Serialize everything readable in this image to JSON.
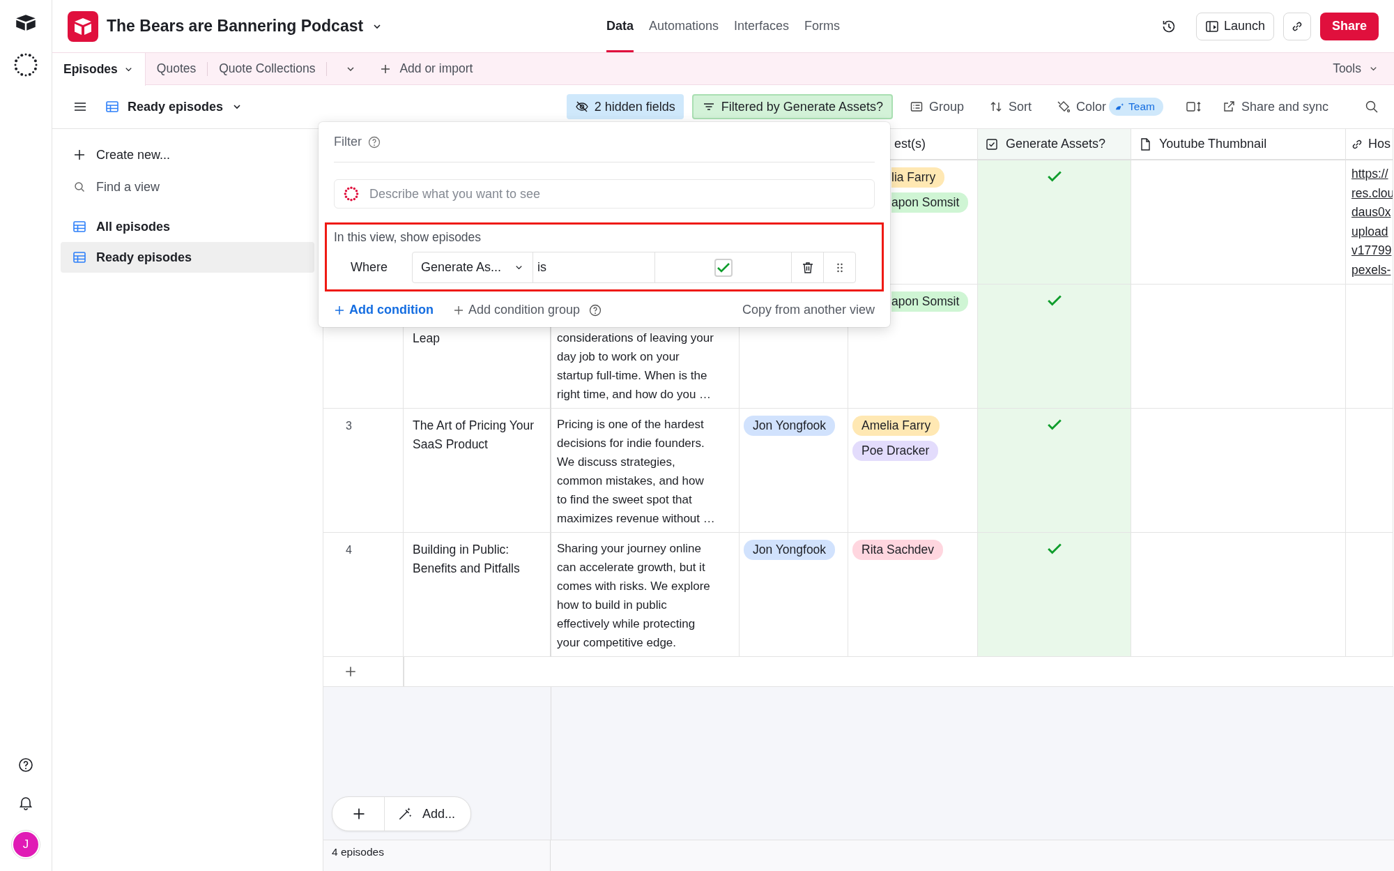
{
  "rail": {
    "avatar": "J"
  },
  "base": {
    "title": "The Bears are Bannering Podcast"
  },
  "nav": [
    {
      "label": "Data",
      "selected": true
    },
    {
      "label": "Automations",
      "selected": false
    },
    {
      "label": "Interfaces",
      "selected": false
    },
    {
      "label": "Forms",
      "selected": false
    }
  ],
  "actions": {
    "launch": "Launch",
    "share": "Share"
  },
  "tables": [
    {
      "label": "Episodes",
      "selected": true
    },
    {
      "label": "Quotes",
      "selected": false
    },
    {
      "label": "Quote Collections",
      "selected": false
    }
  ],
  "add_table": "Add or import",
  "tools": "Tools",
  "view": {
    "name": "Ready episodes"
  },
  "view_tools": [
    {
      "kind": "hidden",
      "label": "2 hidden fields"
    },
    {
      "kind": "filter",
      "label": "Filtered by Generate Assets?"
    },
    {
      "kind": "group",
      "label": "Group"
    },
    {
      "kind": "sort",
      "label": "Sort"
    },
    {
      "kind": "color",
      "label": "Color",
      "badge": "Team"
    },
    {
      "kind": "height"
    },
    {
      "kind": "share",
      "label": "Share and sync"
    },
    {
      "kind": "search"
    }
  ],
  "sidebar": {
    "actions": [
      {
        "kind": "create",
        "label": "Create new..."
      },
      {
        "kind": "find",
        "label": "Find a view"
      }
    ],
    "views": [
      {
        "label": "All episodes",
        "selected": false
      },
      {
        "label": "Ready episodes",
        "selected": true
      }
    ]
  },
  "table": {
    "columns": [
      {
        "kind": "text",
        "label": "est(s)"
      },
      {
        "kind": "checkbox",
        "label": "Generate Assets?"
      },
      {
        "kind": "attachment",
        "label": "Youtube Thumbnail"
      },
      {
        "kind": "url",
        "label": "Hos"
      }
    ],
    "rows": [
      {
        "guests": [
          {
            "name": "lia Farry",
            "color": "#ffe8b3"
          },
          {
            "name": "apon Somsit",
            "color": "#cff5d4"
          }
        ],
        "generate": true,
        "url_lines": [
          "https://",
          "res.clou",
          "daus0x",
          "upload",
          "v17799",
          "pexels-"
        ]
      },
      {
        "title": [
          "Leap"
        ],
        "description": [
          "considerations of leaving your",
          "day job to work on your",
          "startup full-time. When is the",
          "right time, and how do you …"
        ],
        "guests": [
          {
            "name": "apon Somsit",
            "color": "#cff5d4"
          }
        ],
        "generate": true
      },
      {
        "number": "3",
        "title": [
          "The Art of Pricing Your",
          "SaaS Product"
        ],
        "description": [
          "Pricing is one of the hardest",
          "decisions for indie founders.",
          "We discuss strategies,",
          "common mistakes, and how",
          "to find the sweet spot that",
          "maximizes revenue without …"
        ],
        "host": [
          {
            "name": "Jon Yongfook",
            "color": "#d1e2fd"
          }
        ],
        "guests": [
          {
            "name": "Amelia Farry",
            "color": "#ffe8b3"
          },
          {
            "name": "Poe Dracker",
            "color": "#e3dcfc"
          }
        ],
        "generate": true
      },
      {
        "number": "4",
        "title": [
          "Building in Public:",
          "Benefits and Pitfalls"
        ],
        "description": [
          "Sharing your journey online",
          "can accelerate growth, but it",
          "comes with risks. We explore",
          "how to build in public",
          "effectively while protecting",
          "your competitive edge."
        ],
        "host": [
          {
            "name": "Jon Yongfook",
            "color": "#d1e2fd"
          }
        ],
        "guests": [
          {
            "name": "Rita Sachdev",
            "color": "#ffd6df"
          }
        ],
        "generate": true
      }
    ],
    "add_label": "Add...",
    "footer": "4 episodes"
  },
  "filter_popup": {
    "title": "Filter",
    "ai_placeholder": "Describe what you want to see",
    "intro": "In this view, show episodes",
    "where": "Where",
    "field": "Generate As...",
    "operator": "is",
    "value_checked": true,
    "add_condition": "Add condition",
    "add_group": "Add condition group",
    "copy": "Copy from another view"
  }
}
